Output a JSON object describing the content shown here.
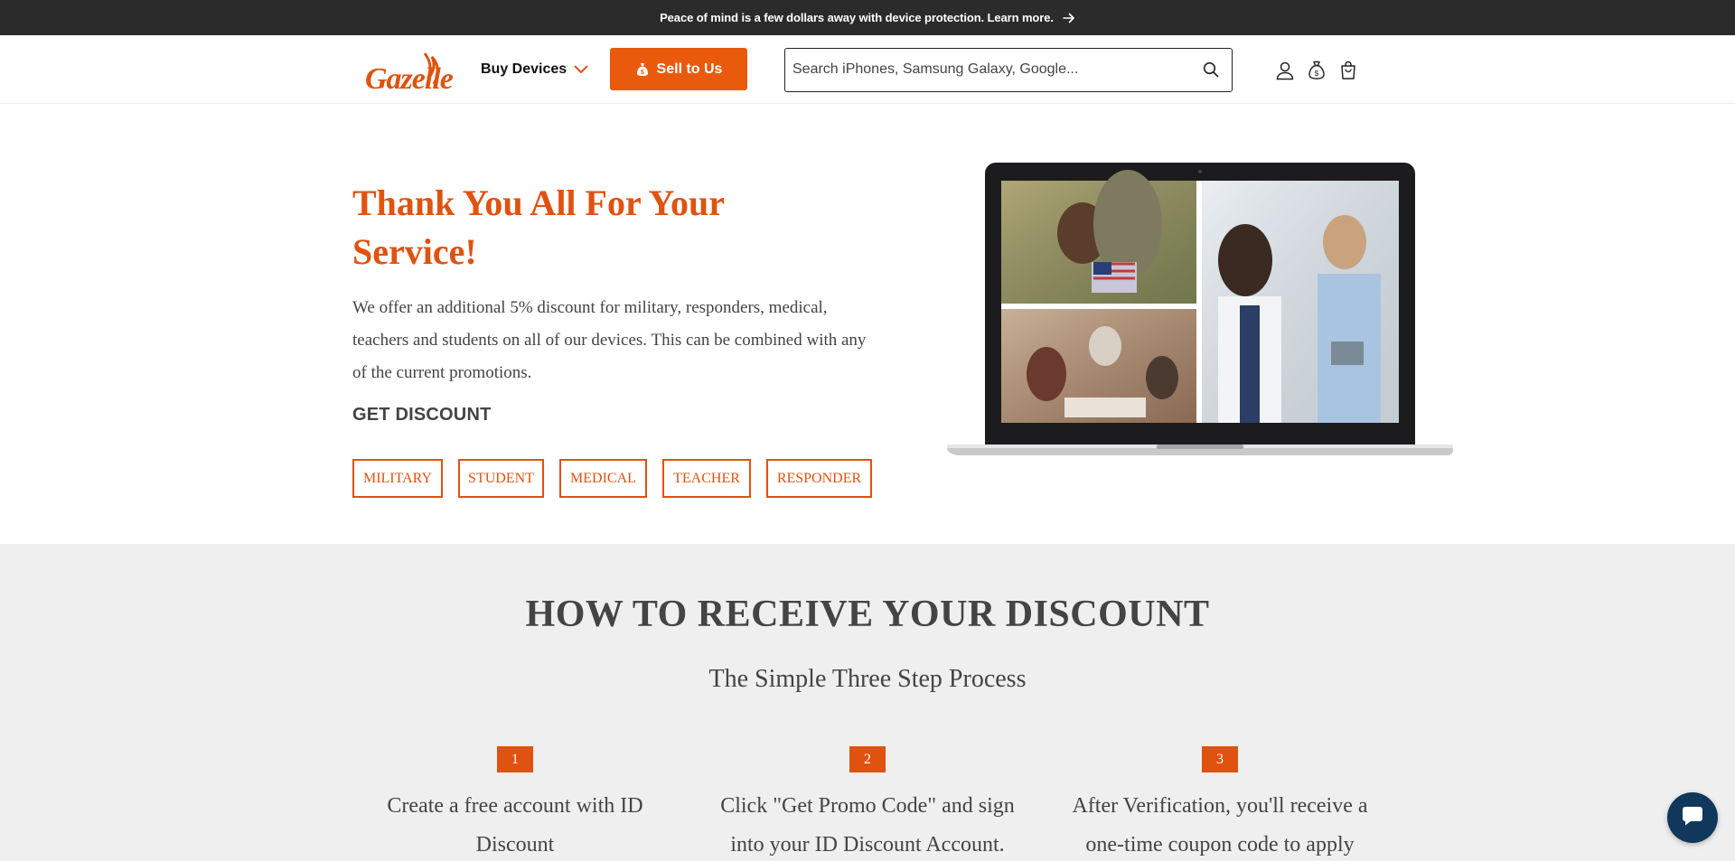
{
  "announcement": {
    "text": "Peace of mind is a few dollars away with device protection. Learn more."
  },
  "header": {
    "logo_text": "Gazelle",
    "buy_devices_label": "Buy Devices",
    "sell_label": "Sell to Us",
    "search_placeholder": "Search iPhones, Samsung Galaxy, Google..."
  },
  "hero": {
    "title": "Thank You All For Your Service!",
    "body": "We offer an additional 5% discount for military, responders, medical, teachers and students on all of our devices. This can be combined with any of the current promotions.",
    "get_discount_label": "GET DISCOUNT",
    "buttons": [
      "MILITARY",
      "STUDENT",
      "MEDICAL",
      "TEACHER",
      "RESPONDER"
    ]
  },
  "steps": {
    "title": "HOW TO RECEIVE YOUR DISCOUNT",
    "subtitle": "The Simple Three Step Process",
    "items": [
      {
        "num": "1",
        "text": "Create a free account with ID Discount"
      },
      {
        "num": "2",
        "text": "Click \"Get Promo Code\" and sign into your ID Discount Account."
      },
      {
        "num": "3",
        "text": "After Verification, you'll receive a one-time coupon code to apply"
      }
    ]
  },
  "colors": {
    "brand_orange": "#e0520f",
    "dark_bar": "#2b2b2b",
    "section_gray": "#efefef",
    "chat_navy": "#10375c"
  }
}
